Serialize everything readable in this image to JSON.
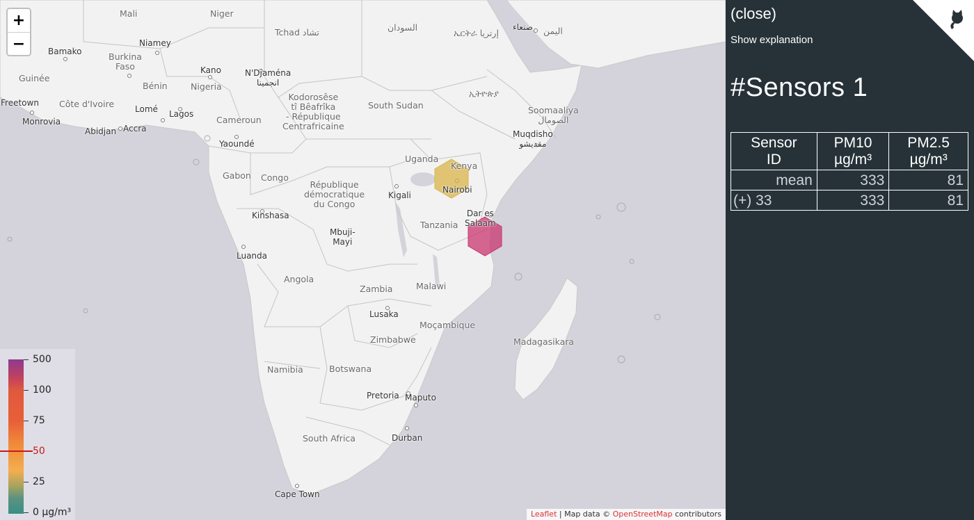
{
  "map": {
    "zoom": {
      "in_label": "+",
      "out_label": "−"
    },
    "places": [
      {
        "id": "mali",
        "text": "Mali",
        "kind": "country"
      },
      {
        "id": "niger",
        "text": "Niger",
        "kind": "country"
      },
      {
        "id": "tchad",
        "text": "Tchad تشاد",
        "kind": "country"
      },
      {
        "id": "sudan",
        "text": "السودان",
        "kind": "country"
      },
      {
        "id": "eritrea",
        "text": "ኤርትራ إرتريا",
        "kind": "country"
      },
      {
        "id": "sanaa",
        "text": "صنعاء",
        "kind": "city"
      },
      {
        "id": "yemen",
        "text": "اليمن",
        "kind": "country"
      },
      {
        "id": "bamako",
        "text": "Bamako",
        "kind": "city"
      },
      {
        "id": "niamey",
        "text": "Niamey",
        "kind": "city"
      },
      {
        "id": "burkina",
        "text": "Burkina\nFaso",
        "kind": "country"
      },
      {
        "id": "guinee",
        "text": "Guinée",
        "kind": "country"
      },
      {
        "id": "kano",
        "text": "Kano",
        "kind": "city"
      },
      {
        "id": "ndjamena",
        "text": "N'Djaména\nانجمينا",
        "kind": "city"
      },
      {
        "id": "ethiopia",
        "text": "ኢትዮጵያ",
        "kind": "country"
      },
      {
        "id": "benin",
        "text": "Bénin",
        "kind": "country"
      },
      {
        "id": "nigeria",
        "text": "Nigeria",
        "kind": "country"
      },
      {
        "id": "car",
        "text": "Kodorosêse\ntî Bêafrîka\n- République\nCentrafricaine",
        "kind": "country"
      },
      {
        "id": "southsudan",
        "text": "South Sudan",
        "kind": "country"
      },
      {
        "id": "freetown",
        "text": "Freetown",
        "kind": "city"
      },
      {
        "id": "cotedivoire",
        "text": "Côte d'Ivoire",
        "kind": "country"
      },
      {
        "id": "lome",
        "text": "Lomé",
        "kind": "city"
      },
      {
        "id": "lagos",
        "text": "Lagos",
        "kind": "city"
      },
      {
        "id": "cameroun",
        "text": "Cameroun",
        "kind": "country"
      },
      {
        "id": "somalia",
        "text": "Soomaaliya\nالصومال",
        "kind": "country"
      },
      {
        "id": "monrovia",
        "text": "Monrovia",
        "kind": "city"
      },
      {
        "id": "abidjan",
        "text": "Abidjan",
        "kind": "city"
      },
      {
        "id": "accra",
        "text": "Accra",
        "kind": "city"
      },
      {
        "id": "mogadishu",
        "text": "Muqdisho\nمقديشو",
        "kind": "city"
      },
      {
        "id": "yaounde",
        "text": "Yaoundé",
        "kind": "city"
      },
      {
        "id": "uganda",
        "text": "Uganda",
        "kind": "country"
      },
      {
        "id": "kenya",
        "text": "Kenya",
        "kind": "country"
      },
      {
        "id": "gabon",
        "text": "Gabon",
        "kind": "country"
      },
      {
        "id": "congo",
        "text": "Congo",
        "kind": "country"
      },
      {
        "id": "drc",
        "text": "République\ndémocratique\ndu Congo",
        "kind": "country"
      },
      {
        "id": "nairobi",
        "text": "Nairobi",
        "kind": "city"
      },
      {
        "id": "kigali",
        "text": "Kigali",
        "kind": "city"
      },
      {
        "id": "kinshasa",
        "text": "Kinshasa",
        "kind": "city"
      },
      {
        "id": "daressalaam",
        "text": "Dar es\nSalaam",
        "kind": "city"
      },
      {
        "id": "tanzania",
        "text": "Tanzania",
        "kind": "country"
      },
      {
        "id": "mbujimayi",
        "text": "Mbuji-\nMayi",
        "kind": "city"
      },
      {
        "id": "luanda",
        "text": "Luanda",
        "kind": "city"
      },
      {
        "id": "angola",
        "text": "Angola",
        "kind": "country"
      },
      {
        "id": "malawi",
        "text": "Malawi",
        "kind": "country"
      },
      {
        "id": "zambia",
        "text": "Zambia",
        "kind": "country"
      },
      {
        "id": "lusaka",
        "text": "Lusaka",
        "kind": "city"
      },
      {
        "id": "mocambique",
        "text": "Moçambique",
        "kind": "country"
      },
      {
        "id": "zimbabwe",
        "text": "Zimbabwe",
        "kind": "country"
      },
      {
        "id": "madagasikara",
        "text": "Madagasikara",
        "kind": "country"
      },
      {
        "id": "namibia",
        "text": "Namibia",
        "kind": "country"
      },
      {
        "id": "botswana",
        "text": "Botswana",
        "kind": "country"
      },
      {
        "id": "pretoria",
        "text": "Pretoria",
        "kind": "city"
      },
      {
        "id": "maputo",
        "text": "Maputo",
        "kind": "city"
      },
      {
        "id": "southafrica",
        "text": "South Africa",
        "kind": "country"
      },
      {
        "id": "durban",
        "text": "Durban",
        "kind": "city"
      },
      {
        "id": "capetown",
        "text": "Cape Town",
        "kind": "city"
      }
    ],
    "hexagons": [
      {
        "name": "hexagon-nairobi",
        "color": "#d9b44a",
        "opacity": 0.75,
        "pm10": 333,
        "pm25": 81
      },
      {
        "name": "hexagon-dar-es-salaam",
        "color": "#c8356f",
        "opacity": 0.75,
        "pm10": 333,
        "pm25": 81
      }
    ],
    "colors": {
      "water": "#d4d2db",
      "land": "#f2f2f2",
      "border": "#c4c4c4"
    }
  },
  "legend": {
    "labels": [
      "500",
      "100",
      "75",
      "50",
      "25",
      "0 µg/m³"
    ],
    "active": "50",
    "active_color": "#c41b1b"
  },
  "attribution": {
    "leaflet": "Leaflet",
    "separator": " | Map data © ",
    "osm": "OpenStreetMap",
    "suffix": " contributors"
  },
  "panel": {
    "close": "(close)",
    "explanation": "Show explanation",
    "title": "#Sensors 1",
    "background": "#263238",
    "table": {
      "headers": [
        "Sensor\nID",
        "PM10\nµg/m³",
        "PM2.5\nµg/m³"
      ],
      "rows": [
        {
          "label": "mean",
          "pm10": "333",
          "pm25": "81"
        },
        {
          "label": "(+) 33",
          "pm10": "333",
          "pm25": "81"
        }
      ]
    }
  }
}
